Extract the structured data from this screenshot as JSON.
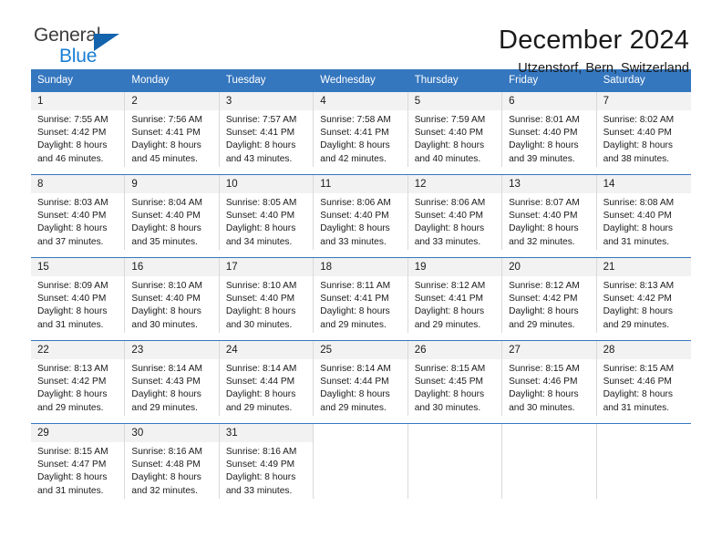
{
  "brand": {
    "name_part1": "General",
    "name_part2": "Blue",
    "triangle_icon": "triangle-icon",
    "accent_color": "#1364ad",
    "blue_text_color": "#1a7fd4"
  },
  "header": {
    "title": "December 2024",
    "subtitle": "Utzenstorf, Bern, Switzerland"
  },
  "calendar": {
    "header_bg": "#3577bf",
    "day_band_bg": "#f2f2f2",
    "weekdays": [
      "Sunday",
      "Monday",
      "Tuesday",
      "Wednesday",
      "Thursday",
      "Friday",
      "Saturday"
    ],
    "weeks": [
      [
        {
          "day": "1",
          "sunrise": "Sunrise: 7:55 AM",
          "sunset": "Sunset: 4:42 PM",
          "daylight_line1": "Daylight: 8 hours",
          "daylight_line2": "and 46 minutes."
        },
        {
          "day": "2",
          "sunrise": "Sunrise: 7:56 AM",
          "sunset": "Sunset: 4:41 PM",
          "daylight_line1": "Daylight: 8 hours",
          "daylight_line2": "and 45 minutes."
        },
        {
          "day": "3",
          "sunrise": "Sunrise: 7:57 AM",
          "sunset": "Sunset: 4:41 PM",
          "daylight_line1": "Daylight: 8 hours",
          "daylight_line2": "and 43 minutes."
        },
        {
          "day": "4",
          "sunrise": "Sunrise: 7:58 AM",
          "sunset": "Sunset: 4:41 PM",
          "daylight_line1": "Daylight: 8 hours",
          "daylight_line2": "and 42 minutes."
        },
        {
          "day": "5",
          "sunrise": "Sunrise: 7:59 AM",
          "sunset": "Sunset: 4:40 PM",
          "daylight_line1": "Daylight: 8 hours",
          "daylight_line2": "and 40 minutes."
        },
        {
          "day": "6",
          "sunrise": "Sunrise: 8:01 AM",
          "sunset": "Sunset: 4:40 PM",
          "daylight_line1": "Daylight: 8 hours",
          "daylight_line2": "and 39 minutes."
        },
        {
          "day": "7",
          "sunrise": "Sunrise: 8:02 AM",
          "sunset": "Sunset: 4:40 PM",
          "daylight_line1": "Daylight: 8 hours",
          "daylight_line2": "and 38 minutes."
        }
      ],
      [
        {
          "day": "8",
          "sunrise": "Sunrise: 8:03 AM",
          "sunset": "Sunset: 4:40 PM",
          "daylight_line1": "Daylight: 8 hours",
          "daylight_line2": "and 37 minutes."
        },
        {
          "day": "9",
          "sunrise": "Sunrise: 8:04 AM",
          "sunset": "Sunset: 4:40 PM",
          "daylight_line1": "Daylight: 8 hours",
          "daylight_line2": "and 35 minutes."
        },
        {
          "day": "10",
          "sunrise": "Sunrise: 8:05 AM",
          "sunset": "Sunset: 4:40 PM",
          "daylight_line1": "Daylight: 8 hours",
          "daylight_line2": "and 34 minutes."
        },
        {
          "day": "11",
          "sunrise": "Sunrise: 8:06 AM",
          "sunset": "Sunset: 4:40 PM",
          "daylight_line1": "Daylight: 8 hours",
          "daylight_line2": "and 33 minutes."
        },
        {
          "day": "12",
          "sunrise": "Sunrise: 8:06 AM",
          "sunset": "Sunset: 4:40 PM",
          "daylight_line1": "Daylight: 8 hours",
          "daylight_line2": "and 33 minutes."
        },
        {
          "day": "13",
          "sunrise": "Sunrise: 8:07 AM",
          "sunset": "Sunset: 4:40 PM",
          "daylight_line1": "Daylight: 8 hours",
          "daylight_line2": "and 32 minutes."
        },
        {
          "day": "14",
          "sunrise": "Sunrise: 8:08 AM",
          "sunset": "Sunset: 4:40 PM",
          "daylight_line1": "Daylight: 8 hours",
          "daylight_line2": "and 31 minutes."
        }
      ],
      [
        {
          "day": "15",
          "sunrise": "Sunrise: 8:09 AM",
          "sunset": "Sunset: 4:40 PM",
          "daylight_line1": "Daylight: 8 hours",
          "daylight_line2": "and 31 minutes."
        },
        {
          "day": "16",
          "sunrise": "Sunrise: 8:10 AM",
          "sunset": "Sunset: 4:40 PM",
          "daylight_line1": "Daylight: 8 hours",
          "daylight_line2": "and 30 minutes."
        },
        {
          "day": "17",
          "sunrise": "Sunrise: 8:10 AM",
          "sunset": "Sunset: 4:40 PM",
          "daylight_line1": "Daylight: 8 hours",
          "daylight_line2": "and 30 minutes."
        },
        {
          "day": "18",
          "sunrise": "Sunrise: 8:11 AM",
          "sunset": "Sunset: 4:41 PM",
          "daylight_line1": "Daylight: 8 hours",
          "daylight_line2": "and 29 minutes."
        },
        {
          "day": "19",
          "sunrise": "Sunrise: 8:12 AM",
          "sunset": "Sunset: 4:41 PM",
          "daylight_line1": "Daylight: 8 hours",
          "daylight_line2": "and 29 minutes."
        },
        {
          "day": "20",
          "sunrise": "Sunrise: 8:12 AM",
          "sunset": "Sunset: 4:42 PM",
          "daylight_line1": "Daylight: 8 hours",
          "daylight_line2": "and 29 minutes."
        },
        {
          "day": "21",
          "sunrise": "Sunrise: 8:13 AM",
          "sunset": "Sunset: 4:42 PM",
          "daylight_line1": "Daylight: 8 hours",
          "daylight_line2": "and 29 minutes."
        }
      ],
      [
        {
          "day": "22",
          "sunrise": "Sunrise: 8:13 AM",
          "sunset": "Sunset: 4:42 PM",
          "daylight_line1": "Daylight: 8 hours",
          "daylight_line2": "and 29 minutes."
        },
        {
          "day": "23",
          "sunrise": "Sunrise: 8:14 AM",
          "sunset": "Sunset: 4:43 PM",
          "daylight_line1": "Daylight: 8 hours",
          "daylight_line2": "and 29 minutes."
        },
        {
          "day": "24",
          "sunrise": "Sunrise: 8:14 AM",
          "sunset": "Sunset: 4:44 PM",
          "daylight_line1": "Daylight: 8 hours",
          "daylight_line2": "and 29 minutes."
        },
        {
          "day": "25",
          "sunrise": "Sunrise: 8:14 AM",
          "sunset": "Sunset: 4:44 PM",
          "daylight_line1": "Daylight: 8 hours",
          "daylight_line2": "and 29 minutes."
        },
        {
          "day": "26",
          "sunrise": "Sunrise: 8:15 AM",
          "sunset": "Sunset: 4:45 PM",
          "daylight_line1": "Daylight: 8 hours",
          "daylight_line2": "and 30 minutes."
        },
        {
          "day": "27",
          "sunrise": "Sunrise: 8:15 AM",
          "sunset": "Sunset: 4:46 PM",
          "daylight_line1": "Daylight: 8 hours",
          "daylight_line2": "and 30 minutes."
        },
        {
          "day": "28",
          "sunrise": "Sunrise: 8:15 AM",
          "sunset": "Sunset: 4:46 PM",
          "daylight_line1": "Daylight: 8 hours",
          "daylight_line2": "and 31 minutes."
        }
      ],
      [
        {
          "day": "29",
          "sunrise": "Sunrise: 8:15 AM",
          "sunset": "Sunset: 4:47 PM",
          "daylight_line1": "Daylight: 8 hours",
          "daylight_line2": "and 31 minutes."
        },
        {
          "day": "30",
          "sunrise": "Sunrise: 8:16 AM",
          "sunset": "Sunset: 4:48 PM",
          "daylight_line1": "Daylight: 8 hours",
          "daylight_line2": "and 32 minutes."
        },
        {
          "day": "31",
          "sunrise": "Sunrise: 8:16 AM",
          "sunset": "Sunset: 4:49 PM",
          "daylight_line1": "Daylight: 8 hours",
          "daylight_line2": "and 33 minutes."
        },
        {
          "day": "",
          "sunrise": "",
          "sunset": "",
          "daylight_line1": "",
          "daylight_line2": ""
        },
        {
          "day": "",
          "sunrise": "",
          "sunset": "",
          "daylight_line1": "",
          "daylight_line2": ""
        },
        {
          "day": "",
          "sunrise": "",
          "sunset": "",
          "daylight_line1": "",
          "daylight_line2": ""
        },
        {
          "day": "",
          "sunrise": "",
          "sunset": "",
          "daylight_line1": "",
          "daylight_line2": ""
        }
      ]
    ]
  }
}
